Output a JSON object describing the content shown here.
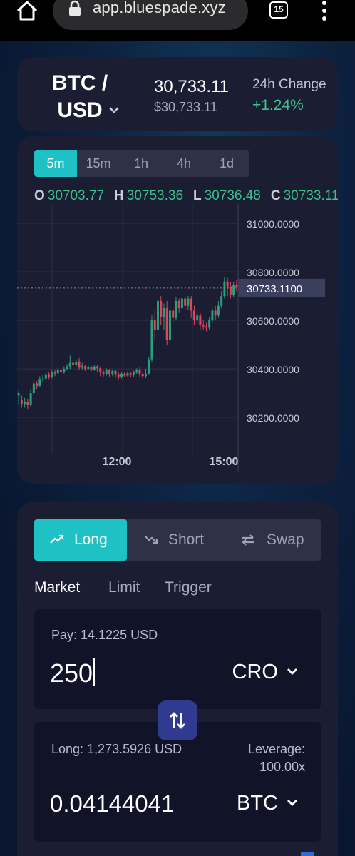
{
  "browser": {
    "url": "app.bluespade.xyz",
    "tab_count": "15"
  },
  "pair": {
    "name": "BTC / USD",
    "price": "30,733.11",
    "price_usd": "$30,733.11",
    "change_label": "24h Change",
    "change_value": "+1.24%",
    "positive_color": "#39c28a"
  },
  "chart": {
    "timeframes": [
      "5m",
      "15m",
      "1h",
      "4h",
      "1d"
    ],
    "active_timeframe": "5m",
    "ohlc": {
      "o_label": "O",
      "o": "30703.77",
      "h_label": "H",
      "h": "30753.36",
      "l_label": "L",
      "l": "30736.48",
      "c_label": "C",
      "c": "30733.11"
    },
    "current_price_tag": "30733.1100",
    "accent_color": "#1fc2c4"
  },
  "chart_data": {
    "type": "candlestick",
    "y_tick_labels": [
      "31000.0000",
      "30800.0000",
      "30600.0000",
      "30400.0000",
      "30200.0000"
    ],
    "y_ticks": [
      31000,
      30800,
      30600,
      30400,
      30200
    ],
    "ylim": [
      30050,
      31080
    ],
    "x_tick_labels": [
      "12:00",
      "15:00"
    ],
    "last_price": 30733.11,
    "up_color": "#26a17b",
    "down_color": "#e0455c",
    "candles": [
      [
        30290,
        30300,
        30250,
        30310
      ],
      [
        30270,
        30255,
        30240,
        30290
      ],
      [
        30255,
        30262,
        30240,
        30280
      ],
      [
        30262,
        30250,
        30235,
        30275
      ],
      [
        30250,
        30300,
        30245,
        30315
      ],
      [
        30300,
        30340,
        30290,
        30360
      ],
      [
        30340,
        30330,
        30315,
        30350
      ],
      [
        30330,
        30355,
        30325,
        30370
      ],
      [
        30355,
        30360,
        30345,
        30375
      ],
      [
        30360,
        30375,
        30350,
        30390
      ],
      [
        30375,
        30368,
        30355,
        30385
      ],
      [
        30368,
        30385,
        30360,
        30395
      ],
      [
        30385,
        30382,
        30370,
        30395
      ],
      [
        30382,
        30395,
        30375,
        30405
      ],
      [
        30395,
        30388,
        30380,
        30400
      ],
      [
        30388,
        30400,
        30380,
        30410
      ],
      [
        30400,
        30410,
        30395,
        30420
      ],
      [
        30410,
        30425,
        30400,
        30455
      ],
      [
        30425,
        30418,
        30405,
        30435
      ],
      [
        30418,
        30430,
        30410,
        30440
      ],
      [
        30430,
        30405,
        30395,
        30445
      ],
      [
        30405,
        30412,
        30395,
        30425
      ],
      [
        30412,
        30400,
        30392,
        30418
      ],
      [
        30400,
        30408,
        30395,
        30415
      ],
      [
        30408,
        30398,
        30390,
        30412
      ],
      [
        30398,
        30410,
        30392,
        30418
      ],
      [
        30410,
        30402,
        30388,
        30415
      ],
      [
        30402,
        30385,
        30370,
        30410
      ],
      [
        30385,
        30380,
        30368,
        30395
      ],
      [
        30380,
        30395,
        30372,
        30402
      ],
      [
        30395,
        30378,
        30368,
        30400
      ],
      [
        30378,
        30392,
        30370,
        30398
      ],
      [
        30392,
        30375,
        30362,
        30398
      ],
      [
        30375,
        30368,
        30355,
        30385
      ],
      [
        30368,
        30380,
        30360,
        30388
      ],
      [
        30380,
        30372,
        30365,
        30386
      ],
      [
        30372,
        30382,
        30366,
        30390
      ],
      [
        30382,
        30375,
        30368,
        30388
      ],
      [
        30375,
        30385,
        30368,
        30392
      ],
      [
        30385,
        30395,
        30378,
        30402
      ],
      [
        30395,
        30378,
        30365,
        30410
      ],
      [
        30378,
        30370,
        30360,
        30390
      ],
      [
        30370,
        30380,
        30362,
        30400
      ],
      [
        30380,
        30440,
        30375,
        30450
      ],
      [
        30440,
        30600,
        30430,
        30620
      ],
      [
        30600,
        30560,
        30520,
        30640
      ],
      [
        30560,
        30680,
        30550,
        30690
      ],
      [
        30680,
        30615,
        30580,
        30700
      ],
      [
        30615,
        30650,
        30560,
        30670
      ],
      [
        30650,
        30520,
        30500,
        30680
      ],
      [
        30520,
        30640,
        30510,
        30660
      ],
      [
        30640,
        30610,
        30590,
        30650
      ],
      [
        30610,
        30680,
        30600,
        30695
      ],
      [
        30680,
        30650,
        30630,
        30690
      ],
      [
        30650,
        30690,
        30640,
        30700
      ],
      [
        30690,
        30660,
        30640,
        30700
      ],
      [
        30660,
        30690,
        30645,
        30700
      ],
      [
        30690,
        30640,
        30610,
        30700
      ],
      [
        30640,
        30600,
        30580,
        30660
      ],
      [
        30600,
        30620,
        30585,
        30640
      ],
      [
        30620,
        30580,
        30560,
        30630
      ],
      [
        30580,
        30575,
        30560,
        30600
      ],
      [
        30575,
        30570,
        30555,
        30590
      ],
      [
        30570,
        30600,
        30560,
        30615
      ],
      [
        30600,
        30640,
        30590,
        30650
      ],
      [
        30640,
        30620,
        30600,
        30660
      ],
      [
        30620,
        30660,
        30610,
        30680
      ],
      [
        30660,
        30700,
        30650,
        30720
      ],
      [
        30700,
        30760,
        30690,
        30780
      ],
      [
        30760,
        30740,
        30700,
        30775
      ],
      [
        30740,
        30705,
        30690,
        30760
      ],
      [
        30705,
        30745,
        30695,
        30760
      ],
      [
        30745,
        30735,
        30720,
        30765
      ]
    ]
  },
  "trade": {
    "side_tabs": {
      "long": "Long",
      "short": "Short",
      "swap": "Swap"
    },
    "order_types": {
      "market": "Market",
      "limit": "Limit",
      "trigger": "Trigger"
    },
    "pay_label": "Pay: 14.1225 USD",
    "pay_amount": "250",
    "pay_token": "CRO",
    "long_label": "Long: 1,273.5926 USD",
    "leverage_label": "Leverage: 100.00x",
    "long_amount": "0.04144041",
    "long_token": "BTC"
  }
}
